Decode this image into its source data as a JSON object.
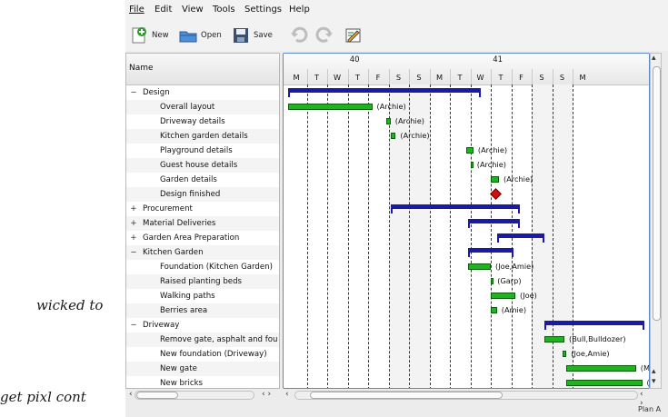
{
  "menu": [
    "File",
    "Edit",
    "View",
    "Tools",
    "Settings",
    "Help"
  ],
  "toolbar": {
    "new": "New",
    "open": "Open",
    "save": "Save"
  },
  "tree": {
    "header": "Name",
    "rows": [
      {
        "label": "Design",
        "level": 0,
        "exp": "−"
      },
      {
        "label": "Overall layout",
        "level": 1
      },
      {
        "label": "Driveway details",
        "level": 1
      },
      {
        "label": "Kitchen garden details",
        "level": 1
      },
      {
        "label": "Playground details",
        "level": 1
      },
      {
        "label": "Guest house details",
        "level": 1
      },
      {
        "label": "Garden details",
        "level": 1
      },
      {
        "label": "Design finished",
        "level": 1
      },
      {
        "label": "Procurement",
        "level": 0,
        "exp": "+"
      },
      {
        "label": "Material Deliveries",
        "level": 0,
        "exp": "+"
      },
      {
        "label": "Garden Area Preparation",
        "level": 0,
        "exp": "+"
      },
      {
        "label": "Kitchen Garden",
        "level": 0,
        "exp": "−"
      },
      {
        "label": "Foundation (Kitchen Garden)",
        "level": 1
      },
      {
        "label": "Raised planting beds",
        "level": 1
      },
      {
        "label": "Walking paths",
        "level": 1
      },
      {
        "label": "Berries area",
        "level": 1
      },
      {
        "label": "Driveway",
        "level": 0,
        "exp": "−"
      },
      {
        "label": "Remove gate, asphalt and fou",
        "level": 1
      },
      {
        "label": "New foundation (Driveway)",
        "level": 1
      },
      {
        "label": "New gate",
        "level": 1
      },
      {
        "label": "New bricks",
        "level": 1
      }
    ]
  },
  "gantt": {
    "weeks": [
      "40",
      "41"
    ],
    "days": [
      "M",
      "T",
      "W",
      "T",
      "F",
      "S",
      "S",
      "M",
      "T",
      "W",
      "T",
      "F",
      "S",
      "S",
      "M"
    ],
    "bars": [
      {
        "row": 0,
        "type": "summary",
        "start": 0.1,
        "end": 9.5
      },
      {
        "row": 1,
        "type": "task",
        "start": 0.1,
        "end": 4.2,
        "res": "(Archie)"
      },
      {
        "row": 2,
        "type": "task",
        "start": 4.9,
        "end": 5.1,
        "res": "(Archie)"
      },
      {
        "row": 3,
        "type": "task",
        "start": 5.1,
        "end": 5.35,
        "res": "(Archie)"
      },
      {
        "row": 4,
        "type": "task",
        "start": 8.8,
        "end": 9.15,
        "res": "(Archie)"
      },
      {
        "row": 5,
        "type": "task",
        "start": 9.0,
        "end": 9.1,
        "res": "(Archie)"
      },
      {
        "row": 6,
        "type": "task",
        "start": 10.0,
        "end": 10.4,
        "res": "(Archie)"
      },
      {
        "row": 7,
        "type": "milestone",
        "start": 10.2
      },
      {
        "row": 8,
        "type": "summary",
        "start": 5.1,
        "end": 11.4
      },
      {
        "row": 9,
        "type": "summary",
        "start": 8.9,
        "end": 11.4
      },
      {
        "row": 10,
        "type": "summary",
        "start": 10.3,
        "end": 12.6
      },
      {
        "row": 11,
        "type": "summary",
        "start": 8.9,
        "end": 11.1
      },
      {
        "row": 12,
        "type": "task",
        "start": 8.9,
        "end": 10.0,
        "res": "(Joe,Amie)"
      },
      {
        "row": 13,
        "type": "task",
        "start": 10.0,
        "end": 10.1,
        "res": "(Garp)"
      },
      {
        "row": 14,
        "type": "task",
        "start": 10.0,
        "end": 11.2,
        "res": "(Joe)"
      },
      {
        "row": 15,
        "type": "task",
        "start": 10.0,
        "end": 10.3,
        "res": "(Amie)"
      },
      {
        "row": 16,
        "type": "summary",
        "start": 12.6,
        "end": 17.5
      },
      {
        "row": 17,
        "type": "task",
        "start": 12.6,
        "end": 13.6,
        "res": "(Bull,Bulldozer)"
      },
      {
        "row": 18,
        "type": "task",
        "start": 13.5,
        "end": 13.7,
        "res": "(Joe,Amie)"
      },
      {
        "row": 19,
        "type": "task",
        "start": 13.7,
        "end": 17.1,
        "res": "(M"
      },
      {
        "row": 20,
        "type": "task",
        "start": 13.7,
        "end": 17.4,
        "res": "("
      }
    ]
  },
  "status": "Plan A",
  "handwriting": [
    "wicked to",
    "get pixl cont"
  ]
}
